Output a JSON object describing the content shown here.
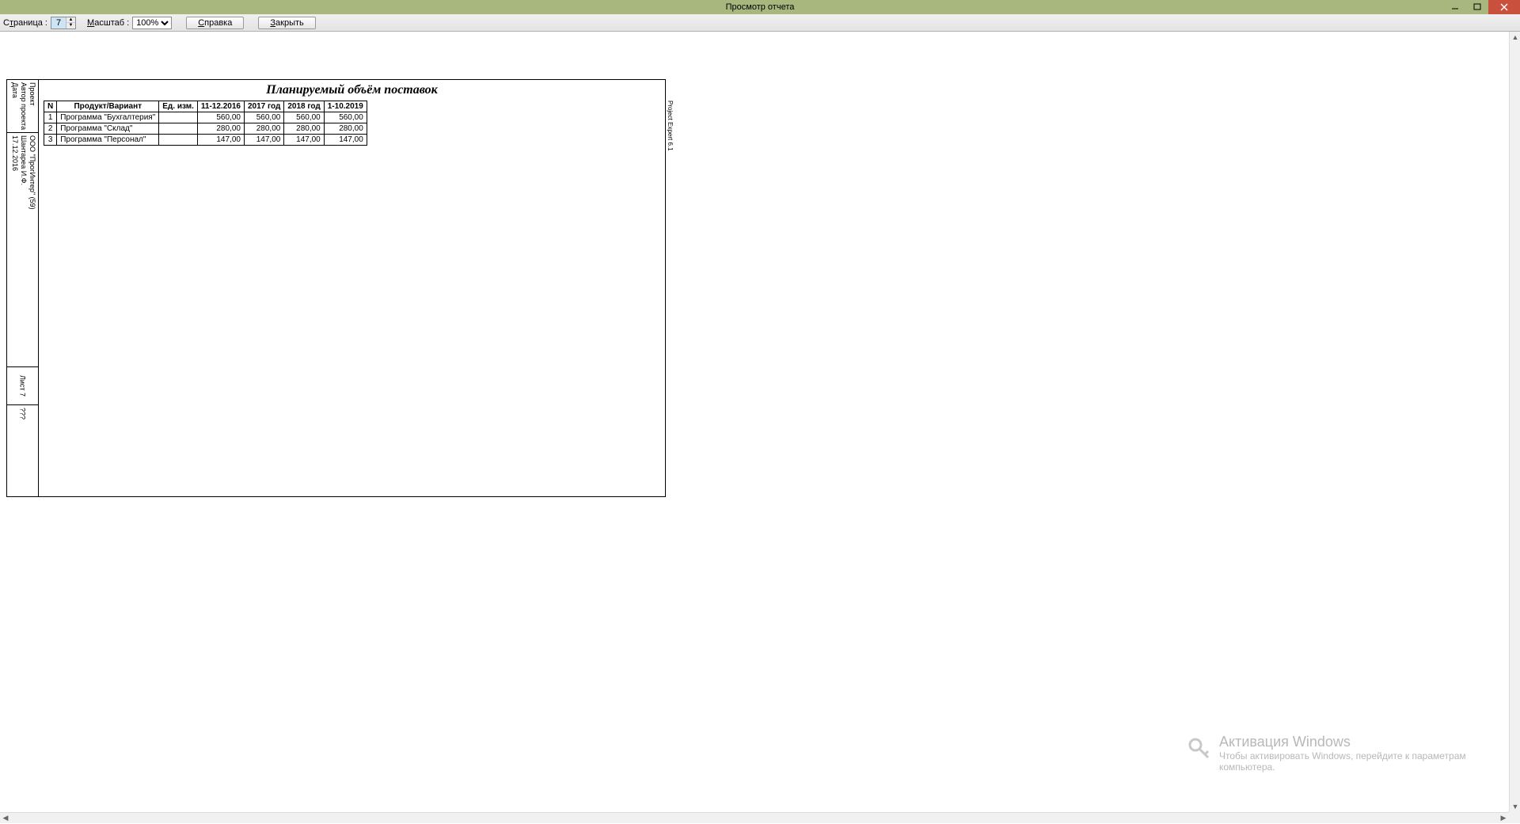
{
  "window": {
    "title": "Просмотр отчета"
  },
  "toolbar": {
    "page_label_pre": "С",
    "page_label_u": "т",
    "page_label_post": "раница :",
    "page_value": "7",
    "zoom_label_u": "М",
    "zoom_label_post": "асштаб :",
    "zoom_value": "100%",
    "help_label_u": "С",
    "help_label_post": "правка",
    "close_label_u": "З",
    "close_label_post": "акрыть"
  },
  "sidebar": {
    "block1": [
      "Проект",
      "Автор проекта",
      "Дата"
    ],
    "block2": [
      "ООО \"ПрогИнтер\" (59)",
      "Шантареа И.Ф.",
      "17.12.2016"
    ],
    "sheet": "Лист 7",
    "qqq": "???"
  },
  "report": {
    "title": "Планируемый объём поставок",
    "right_edge": "Project Expert 6.1",
    "headers": [
      "N",
      "Продукт/Вариант",
      "Ед. изм.",
      "11-12.2016",
      "2017 год",
      "2018 год",
      "1-10.2019"
    ],
    "rows": [
      {
        "n": "1",
        "name": "Программа \"Бухгалтерия\"",
        "unit": "",
        "v": [
          "560,00",
          "560,00",
          "560,00",
          "560,00"
        ]
      },
      {
        "n": "2",
        "name": "Программа \"Склад\"",
        "unit": "",
        "v": [
          "280,00",
          "280,00",
          "280,00",
          "280,00"
        ]
      },
      {
        "n": "3",
        "name": "Программа \"Персонал\"",
        "unit": "",
        "v": [
          "147,00",
          "147,00",
          "147,00",
          "147,00"
        ]
      }
    ]
  },
  "watermark": {
    "line1": "Активация Windows",
    "line2": "Чтобы активировать Windows, перейдите к параметрам компьютера."
  }
}
